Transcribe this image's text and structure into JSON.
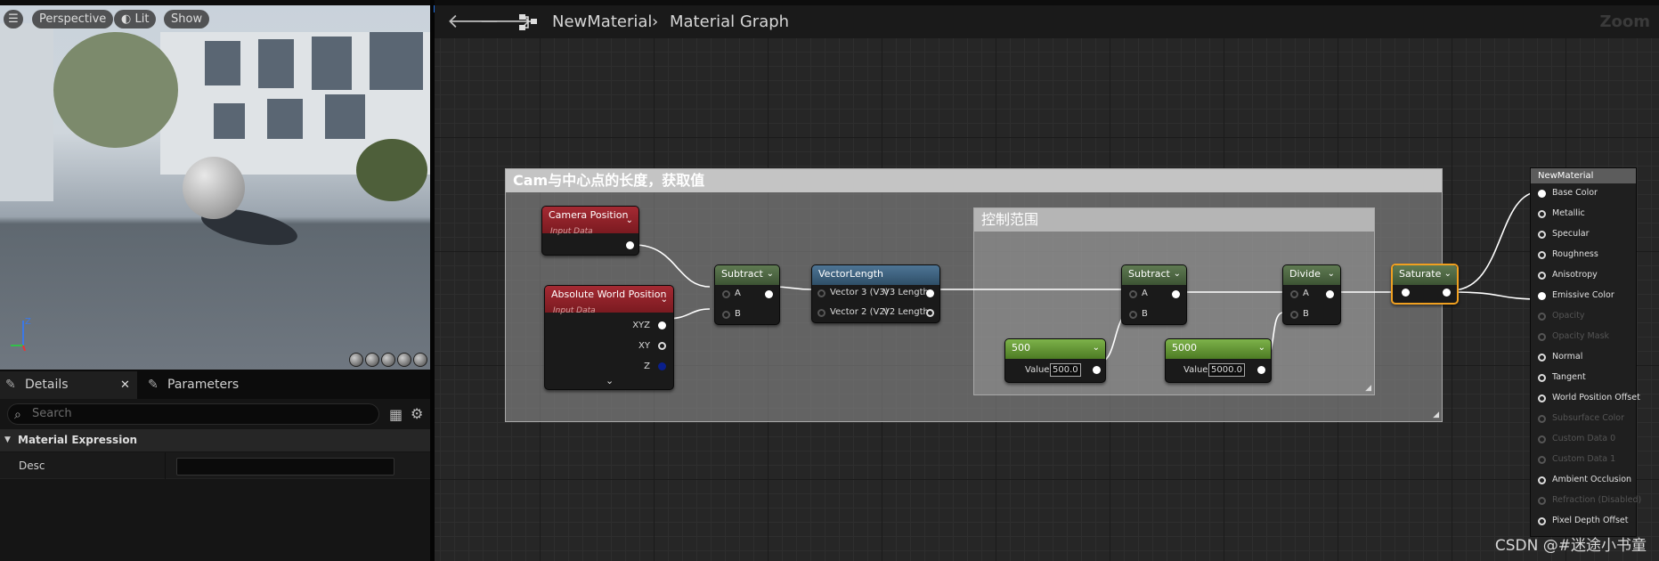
{
  "viewport": {
    "perspective_label": "Perspective",
    "lit_label": "Lit",
    "show_label": "Show"
  },
  "details_panel": {
    "tab_details": "Details",
    "tab_parameters": "Parameters",
    "search_placeholder": "Search",
    "category": "Material Expression",
    "desc_label": "Desc",
    "desc_value": ""
  },
  "graph": {
    "breadcrumb_material": "NewMaterial",
    "breadcrumb_graph": "Material Graph",
    "zoom_label": "Zoom",
    "comment_outer": "Cam与中心点的长度，获取值",
    "comment_inner": "控制范围",
    "nodes": {
      "camera_position": {
        "title": "Camera Position",
        "subtitle": "Input Data"
      },
      "absolute_world_position": {
        "title": "Absolute World Position",
        "subtitle": "Input Data",
        "pins": [
          "XYZ",
          "XY",
          "Z"
        ]
      },
      "subtract1": {
        "title": "Subtract",
        "pins": [
          "A",
          "B"
        ]
      },
      "vector_length": {
        "title": "VectorLength",
        "inputs": [
          "Vector 3 (V3)",
          "Vector 2 (V2)"
        ],
        "outputs": [
          "V3 Length",
          "V2 Length"
        ]
      },
      "const500": {
        "title": "500",
        "value_label": "Value",
        "value": "500.0"
      },
      "const5000": {
        "title": "5000",
        "value_label": "Value",
        "value": "5000.0"
      },
      "subtract2": {
        "title": "Subtract",
        "pins": [
          "A",
          "B"
        ]
      },
      "divide": {
        "title": "Divide",
        "pins": [
          "A",
          "B"
        ]
      },
      "saturate": {
        "title": "Saturate"
      }
    },
    "result_node": {
      "title": "NewMaterial",
      "pins": [
        {
          "label": "Base Color",
          "enabled": true
        },
        {
          "label": "Metallic",
          "enabled": true
        },
        {
          "label": "Specular",
          "enabled": true
        },
        {
          "label": "Roughness",
          "enabled": true
        },
        {
          "label": "Anisotropy",
          "enabled": true
        },
        {
          "label": "Emissive Color",
          "enabled": true
        },
        {
          "label": "Opacity",
          "enabled": false
        },
        {
          "label": "Opacity Mask",
          "enabled": false
        },
        {
          "label": "Normal",
          "enabled": true
        },
        {
          "label": "Tangent",
          "enabled": true
        },
        {
          "label": "World Position Offset",
          "enabled": true
        },
        {
          "label": "Subsurface Color",
          "enabled": false
        },
        {
          "label": "Custom Data 0",
          "enabled": false
        },
        {
          "label": "Custom Data 1",
          "enabled": false
        },
        {
          "label": "Ambient Occlusion",
          "enabled": true
        },
        {
          "label": "Refraction (Disabled)",
          "enabled": false
        },
        {
          "label": "Pixel Depth Offset",
          "enabled": true
        }
      ]
    }
  },
  "watermark": "CSDN @#迷途小书童"
}
